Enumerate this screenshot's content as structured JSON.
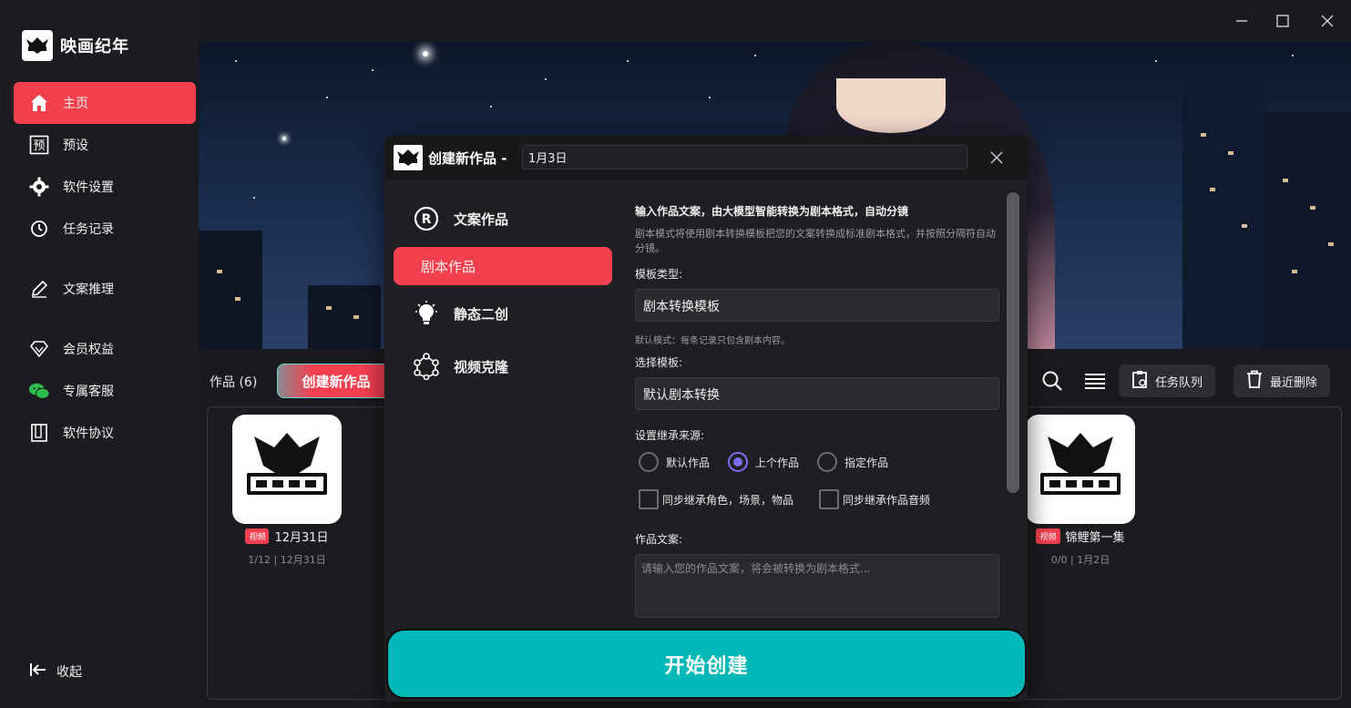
{
  "app": {
    "name": "映画纪年"
  },
  "sidebar": {
    "items": [
      {
        "label": "主页",
        "icon": "home-icon",
        "active": true
      },
      {
        "label": "预设",
        "icon": "preset-icon"
      },
      {
        "label": "软件设置",
        "icon": "gear-icon"
      },
      {
        "label": "任务记录",
        "icon": "history-icon"
      },
      {
        "label": "文案推理",
        "icon": "pen-icon"
      },
      {
        "label": "会员权益",
        "icon": "diamond-icon"
      },
      {
        "label": "专属客服",
        "icon": "wechat-icon"
      },
      {
        "label": "软件协议",
        "icon": "book-icon"
      }
    ],
    "collapse_label": "收起"
  },
  "works": {
    "label": "作品 (6)",
    "create_label": "创建新作品",
    "task_queue_label": "任务队列",
    "recent_delete_label": "最近删除",
    "cards": [
      {
        "tag": "视频",
        "title": "12月31日",
        "meta": "1/12 | 12月31日"
      },
      {
        "tag": "视频",
        "title": "锦鲤第一集",
        "meta": "0/0 | 1月2日"
      }
    ]
  },
  "dialog": {
    "title": "创建新作品 -",
    "name_value": "1月3日",
    "menu": [
      {
        "label": "文案作品",
        "icon": "registered-icon"
      },
      {
        "label": "剧本作品",
        "icon": "",
        "active": true
      },
      {
        "label": "静态二创",
        "icon": "lightbulb-icon"
      },
      {
        "label": "视频克隆",
        "icon": "network-icon"
      }
    ],
    "form": {
      "title": "输入作品文案，由大模型智能转换为剧本格式，自动分镜",
      "desc": "剧本模式将使用剧本转换模板把您的文案转换成标准剧本格式，并按照分隔符自动分镜。",
      "template_type_label": "模板类型:",
      "template_type_value": "剧本转换模板",
      "template_hint": "默认模式：每条记录只包含剧本内容。",
      "select_template_label": "选择模板:",
      "select_template_value": "默认剧本转换",
      "inherit_label": "设置继承来源:",
      "radios": [
        "默认作品",
        "上个作品",
        "指定作品"
      ],
      "radio_selected": "上个作品",
      "checks": [
        "同步继承角色，场景，物品",
        "同步继承作品音频"
      ],
      "text_label": "作品文案:",
      "text_placeholder": "请输入您的作品文案，将会被转换为剧本格式..."
    },
    "start_label": "开始创建"
  },
  "colors": {
    "accent": "#f43f4f",
    "teal": "#00b8b8",
    "radio": "#7c6cf0"
  }
}
